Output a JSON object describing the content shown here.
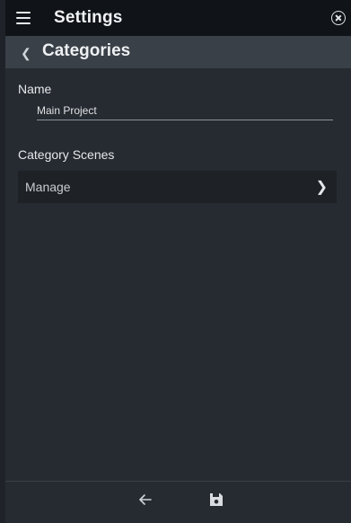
{
  "topbar": {
    "title": "Settings",
    "menu_icon": "menu-icon",
    "close_icon": "close-circle-icon"
  },
  "subheader": {
    "back_icon": "chevron-left-icon",
    "title": "Categories"
  },
  "form": {
    "name_label": "Name",
    "name_value": "Main Project",
    "category_scenes_label": "Category Scenes",
    "manage_label": "Manage",
    "manage_icon": "chevron-right-icon"
  },
  "footer": {
    "back_icon": "arrow-left-icon",
    "save_icon": "floppy-disk-icon"
  },
  "colors": {
    "topbar_bg": "#101317",
    "subheader_bg": "#394048",
    "panel_bg": "#262b31",
    "row_bg": "#1e2227"
  }
}
